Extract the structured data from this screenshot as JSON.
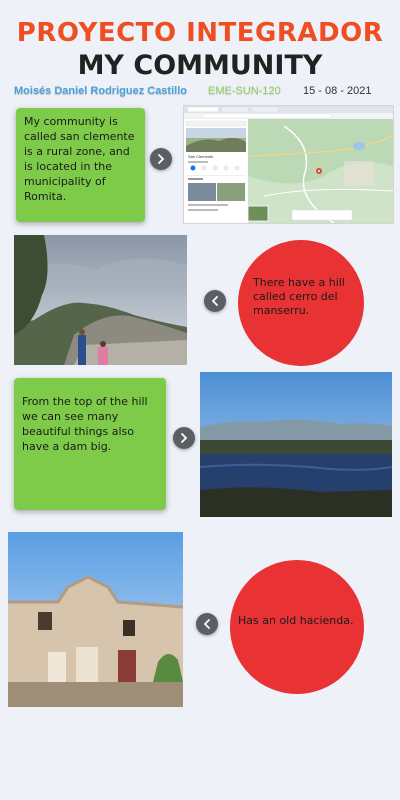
{
  "header": {
    "title": "PROYECTO INTEGRADOR",
    "subtitle": "MY COMMUNITY",
    "author": "Moisés Daniel Rodriguez Castillo",
    "code": "EME-SUN-120",
    "date": "15 - 08 - 2021"
  },
  "cards": [
    {
      "text": "My community is called san clemente is a rural zone, and is located in the municipality of Romita."
    },
    {
      "text": "There have a hill called cerro del manserru."
    },
    {
      "text": "From the top of the hill we can see many beautiful things also have a dam big."
    },
    {
      "text": "Has an old hacienda."
    }
  ],
  "map": {
    "place_name": "San Clemente"
  },
  "colors": {
    "title": "#ef4e23",
    "green": "#7ecb4a",
    "red": "#e83234",
    "author": "#4aa3d8"
  }
}
